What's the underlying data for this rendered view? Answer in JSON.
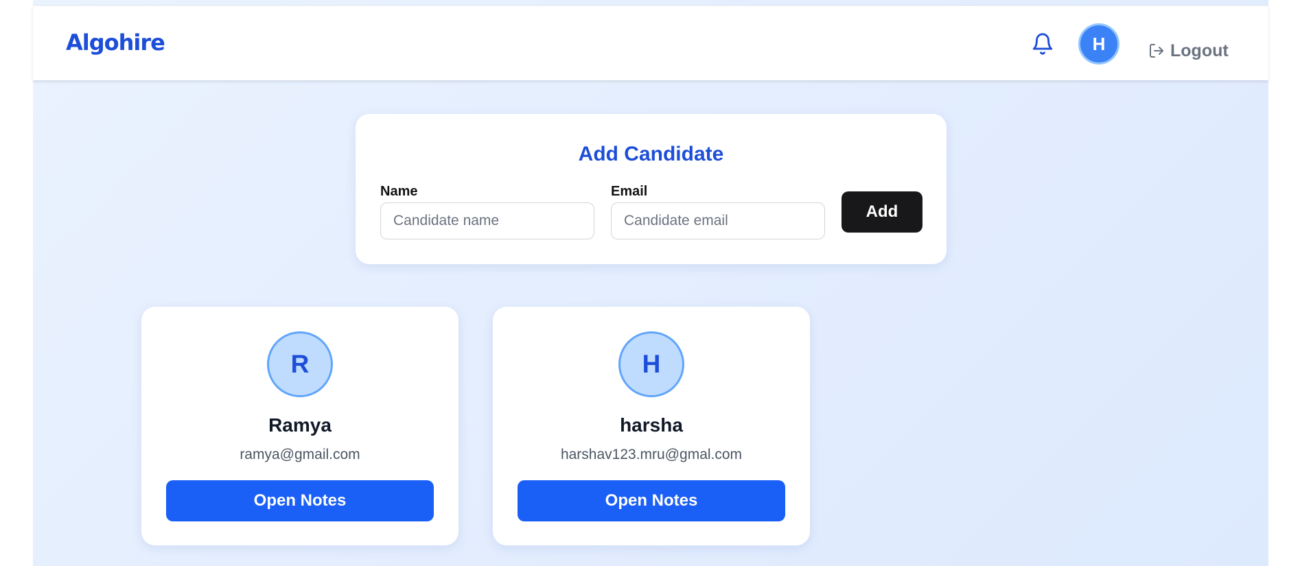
{
  "header": {
    "brand": "Algohire",
    "bell_icon": "bell-icon",
    "user_initial": "H",
    "logout_icon": "logout-icon",
    "logout_label": "Logout"
  },
  "add_candidate": {
    "title": "Add Candidate",
    "name_label": "Name",
    "name_placeholder": "Candidate name",
    "name_value": "",
    "email_label": "Email",
    "email_placeholder": "Candidate email",
    "email_value": "",
    "add_label": "Add"
  },
  "candidates": [
    {
      "initial": "R",
      "name": "Ramya",
      "email": "ramya@gmail.com",
      "button_label": "Open Notes"
    },
    {
      "initial": "H",
      "name": "harsha",
      "email": "harshav123.mru@gmal.com",
      "button_label": "Open Notes"
    }
  ],
  "colors": {
    "brand": "#1d4ed8",
    "primary_button": "#1a5ff6",
    "dark_button": "#18181b",
    "avatar_nav": "#3b82f6",
    "avatar_candidate": "#bfdbfe",
    "background": "#e3edfd"
  }
}
